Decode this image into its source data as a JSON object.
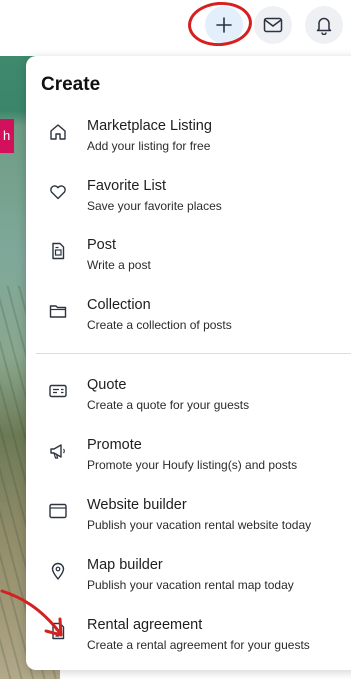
{
  "background": {
    "chip_text": "h"
  },
  "header": {
    "add_icon": "plus-icon",
    "mail_icon": "mail-icon",
    "bell_icon": "bell-icon"
  },
  "menu": {
    "title": "Create",
    "group1": [
      {
        "icon": "home-icon",
        "title": "Marketplace Listing",
        "subtitle": "Add your listing for free"
      },
      {
        "icon": "heart-icon",
        "title": "Favorite List",
        "subtitle": "Save your favorite places"
      },
      {
        "icon": "post-icon",
        "title": "Post",
        "subtitle": "Write a post"
      },
      {
        "icon": "folder-icon",
        "title": "Collection",
        "subtitle": "Create a collection of posts"
      }
    ],
    "group2": [
      {
        "icon": "quote-icon",
        "title": "Quote",
        "subtitle": "Create a quote for your guests"
      },
      {
        "icon": "megaphone-icon",
        "title": "Promote",
        "subtitle": "Promote your Houfy listing(s) and posts"
      },
      {
        "icon": "browser-window-icon",
        "title": "Website builder",
        "subtitle": "Publish your vacation rental website today"
      },
      {
        "icon": "map-pin-icon",
        "title": "Map builder",
        "subtitle": "Publish your vacation rental map today"
      },
      {
        "icon": "document-icon",
        "title": "Rental agreement",
        "subtitle": "Create a rental agreement for your guests"
      }
    ]
  },
  "colors": {
    "annotation_red": "#d62020",
    "add_button_bg": "#e3f0fb",
    "chip_pink": "#d3105c"
  }
}
